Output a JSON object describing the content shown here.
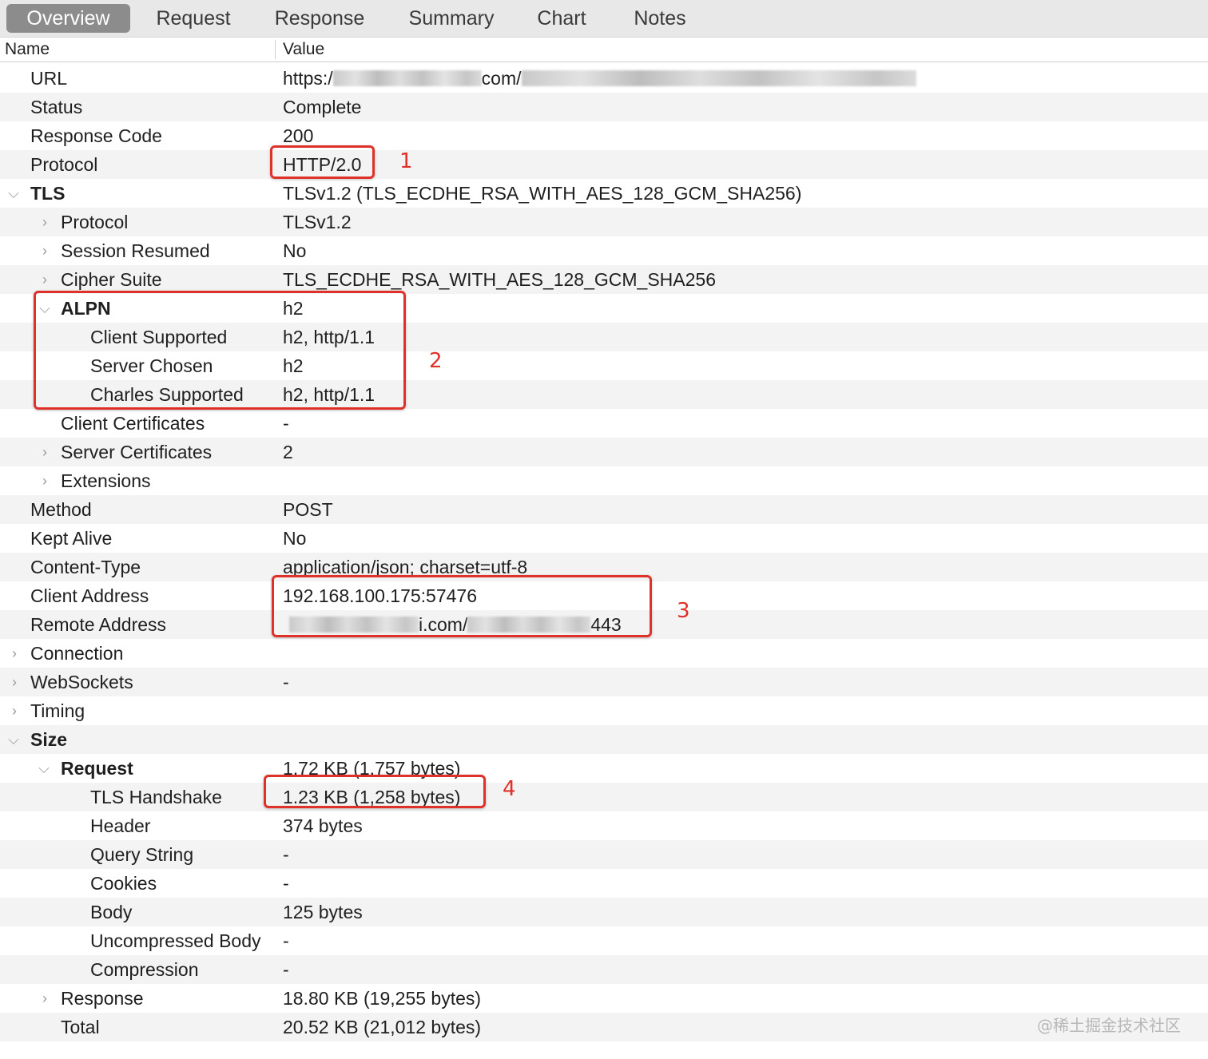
{
  "tabs": [
    {
      "label": "Overview",
      "active": true
    },
    {
      "label": "Request",
      "active": false
    },
    {
      "label": "Response",
      "active": false
    },
    {
      "label": "Summary",
      "active": false
    },
    {
      "label": "Chart",
      "active": false
    },
    {
      "label": "Notes",
      "active": false
    }
  ],
  "columns": {
    "name": "Name",
    "value": "Value"
  },
  "rows": {
    "url": {
      "name": "URL",
      "value_prefix": "https:/",
      "value_mid": "com/"
    },
    "status": {
      "name": "Status",
      "value": "Complete"
    },
    "response_code": {
      "name": "Response Code",
      "value": "200"
    },
    "protocol": {
      "name": "Protocol",
      "value": "HTTP/2.0"
    },
    "tls": {
      "name": "TLS",
      "value": "TLSv1.2 (TLS_ECDHE_RSA_WITH_AES_128_GCM_SHA256)"
    },
    "tls_protocol": {
      "name": "Protocol",
      "value": "TLSv1.2"
    },
    "session_resumed": {
      "name": "Session Resumed",
      "value": "No"
    },
    "cipher_suite": {
      "name": "Cipher Suite",
      "value": "TLS_ECDHE_RSA_WITH_AES_128_GCM_SHA256"
    },
    "alpn": {
      "name": "ALPN",
      "value": "h2"
    },
    "client_supported": {
      "name": "Client Supported",
      "value": "h2, http/1.1"
    },
    "server_chosen": {
      "name": "Server Chosen",
      "value": "h2"
    },
    "charles_supported": {
      "name": "Charles Supported",
      "value": "h2, http/1.1"
    },
    "client_certificates": {
      "name": "Client Certificates",
      "value": "-"
    },
    "server_certificates": {
      "name": "Server Certificates",
      "value": "2"
    },
    "extensions": {
      "name": "Extensions",
      "value": ""
    },
    "method": {
      "name": "Method",
      "value": "POST"
    },
    "kept_alive": {
      "name": "Kept Alive",
      "value": "No"
    },
    "content_type": {
      "name": "Content-Type",
      "value": "application/json; charset=utf-8"
    },
    "client_address": {
      "name": "Client Address",
      "value": "192.168.100.175:57476"
    },
    "remote_address": {
      "name": "Remote Address",
      "value_mid": "i.com/",
      "value_suffix": "443"
    },
    "connection": {
      "name": "Connection",
      "value": ""
    },
    "websockets": {
      "name": "WebSockets",
      "value": "-"
    },
    "timing": {
      "name": "Timing",
      "value": ""
    },
    "size": {
      "name": "Size",
      "value": ""
    },
    "size_request": {
      "name": "Request",
      "value": "1.72 KB (1,757 bytes)"
    },
    "tls_handshake": {
      "name": "TLS Handshake",
      "value": "1.23 KB (1,258 bytes)"
    },
    "header": {
      "name": "Header",
      "value": "374 bytes"
    },
    "query_string": {
      "name": "Query String",
      "value": "-"
    },
    "cookies": {
      "name": "Cookies",
      "value": "-"
    },
    "body": {
      "name": "Body",
      "value": "125 bytes"
    },
    "uncompressed_body": {
      "name": "Uncompressed Body",
      "value": "-"
    },
    "compression": {
      "name": "Compression",
      "value": "-"
    },
    "size_response": {
      "name": "Response",
      "value": "18.80 KB (19,255 bytes)"
    },
    "total": {
      "name": "Total",
      "value": "20.52 KB (21,012 bytes)"
    }
  },
  "annotations": [
    "1",
    "2",
    "3",
    "4"
  ],
  "annotation_color": "#e0302a",
  "watermark": "@稀土掘金技术社区"
}
